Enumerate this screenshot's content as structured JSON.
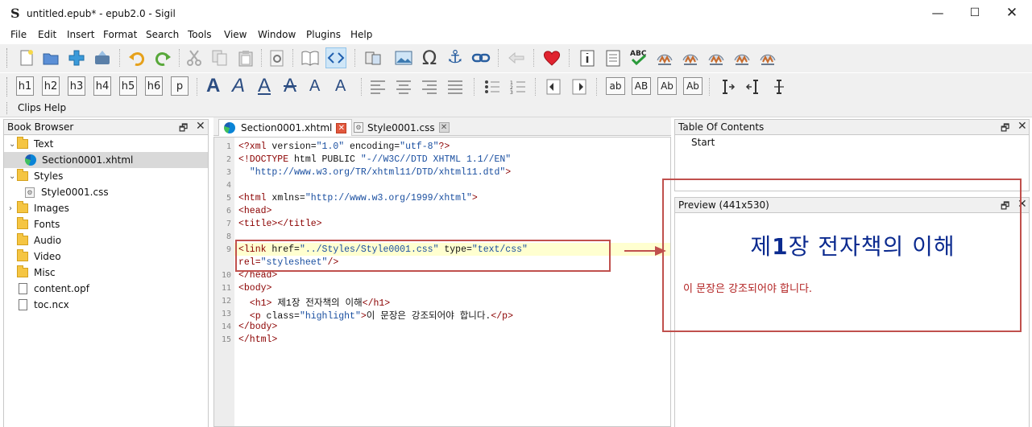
{
  "window": {
    "app_logo": "S",
    "title": "untitled.epub* - epub2.0 - Sigil",
    "minimize": "—",
    "maximize": "☐",
    "close": "✕"
  },
  "menu": [
    "File",
    "Edit",
    "Insert",
    "Format",
    "Search",
    "Tools",
    "View",
    "Window",
    "Plugins",
    "Help"
  ],
  "toolbar_headings": [
    "h1",
    "h2",
    "h3",
    "h4",
    "h5",
    "h6",
    "p"
  ],
  "toolbar_fonts": [
    "A",
    "A",
    "A",
    "A",
    "A",
    "A"
  ],
  "toolbar_case": [
    "ab",
    "AB",
    "Ab",
    "Ab"
  ],
  "clips_bar": {
    "label": "Clips Help"
  },
  "book_browser": {
    "title": "Book Browser",
    "items": [
      {
        "label": "Text",
        "kind": "folder"
      },
      {
        "label": "Section0001.xhtml",
        "kind": "xhtml"
      },
      {
        "label": "Styles",
        "kind": "folder"
      },
      {
        "label": "Style0001.css",
        "kind": "css"
      },
      {
        "label": "Images",
        "kind": "folder"
      },
      {
        "label": "Fonts",
        "kind": "folder"
      },
      {
        "label": "Audio",
        "kind": "folder"
      },
      {
        "label": "Video",
        "kind": "folder"
      },
      {
        "label": "Misc",
        "kind": "folder"
      },
      {
        "label": "content.opf",
        "kind": "file"
      },
      {
        "label": "toc.ncx",
        "kind": "file"
      }
    ]
  },
  "editor": {
    "tabs": [
      {
        "label": "Section0001.xhtml",
        "active": true
      },
      {
        "label": "Style0001.css",
        "active": false
      }
    ],
    "line_numbers": [
      "1",
      "2",
      "3",
      "4",
      "5",
      "6",
      "7",
      "8",
      "9",
      "",
      "10",
      "11",
      "12",
      "13",
      "14",
      "15"
    ],
    "lines": [
      "<?xml version=\"1.0\" encoding=\"utf-8\"?>",
      "<!DOCTYPE html PUBLIC \"-//W3C//DTD XHTML 1.1//EN\"",
      "  \"http://www.w3.org/TR/xhtml11/DTD/xhtml11.dtd\">",
      "",
      "<html xmlns=\"http://www.w3.org/1999/xhtml\">",
      "<head>",
      "<title></title>",
      "",
      "<link href=\"../Styles/Style0001.css\" type=\"text/css\"",
      "rel=\"stylesheet\"/>",
      "</head>",
      "<body>",
      "  <h1> 제1장 전자책의 이해</h1>",
      "  <p class=\"highlight\">이 문장은 강조되어야 합니다.</p>",
      "</body>",
      "</html>"
    ]
  },
  "toc": {
    "title": "Table Of Contents",
    "items": [
      "Start"
    ]
  },
  "preview": {
    "title": "Preview (441x530)",
    "heading": "제1장 전자책의 이해",
    "paragraph": "이 문장은 강조되어야 합니다."
  },
  "colors": {
    "annotation": "#c0504d",
    "preview_heading": "#0b2a8f",
    "preview_paragraph": "#b22222",
    "selection": "#d9d9d9"
  }
}
